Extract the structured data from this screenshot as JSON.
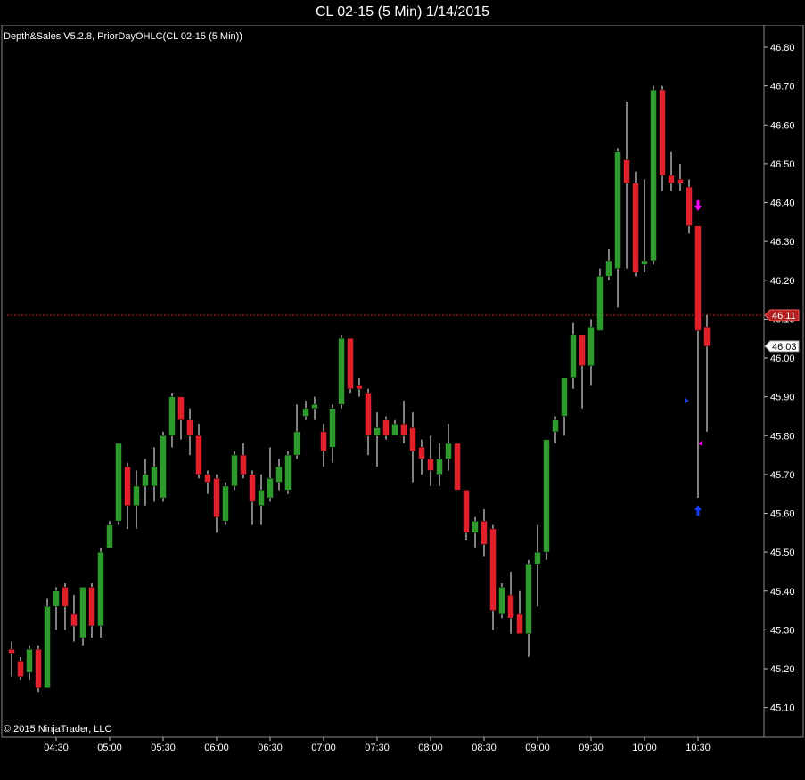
{
  "window": {
    "title": "CL 02-15 (5 Min)  1/14/2015"
  },
  "indicator_label": "Depth&Sales V5.2.8, PriorDayOHLC(CL 02-15 (5 Min))",
  "copyright": "© 2015 NinjaTrader, LLC",
  "colors": {
    "up": "#2e9a2e",
    "down": "#e0202a",
    "background": "#000000",
    "prior_close_line": "#b02020",
    "marker_down": "#ff00ff",
    "marker_up": "#1a3cff"
  },
  "chart_data": {
    "type": "candlestick",
    "title": "CL 02-15 (5 Min)  1/14/2015",
    "y_ticks": [
      "46.80",
      "46.70",
      "46.60",
      "46.50",
      "46.40",
      "46.30",
      "46.20",
      "46.10",
      "46.00",
      "45.90",
      "45.80",
      "45.70",
      "45.60",
      "45.50",
      "45.40",
      "45.30",
      "45.20",
      "45.10"
    ],
    "ylim": [
      45.05,
      46.88
    ],
    "x_ticks": [
      {
        "label": "04:30",
        "bar": 5
      },
      {
        "label": "05:00",
        "bar": 11
      },
      {
        "label": "05:30",
        "bar": 17
      },
      {
        "label": "06:00",
        "bar": 23
      },
      {
        "label": "06:30",
        "bar": 29
      },
      {
        "label": "07:00",
        "bar": 35
      },
      {
        "label": "07:30",
        "bar": 41
      },
      {
        "label": "08:00",
        "bar": 47
      },
      {
        "label": "08:30",
        "bar": 53
      },
      {
        "label": "09:00",
        "bar": 59
      },
      {
        "label": "09:30",
        "bar": 65
      },
      {
        "label": "10:00",
        "bar": 71
      },
      {
        "label": "10:30",
        "bar": 77
      }
    ],
    "prior_day_close": {
      "value": 46.11,
      "label": "46.11"
    },
    "last_price": {
      "value": 46.03,
      "label": "46.03"
    },
    "grid": false,
    "candles": [
      [
        45.25,
        45.24,
        45.27,
        45.18
      ],
      [
        45.22,
        45.18,
        45.23,
        45.17
      ],
      [
        45.19,
        45.25,
        45.26,
        45.17
      ],
      [
        45.25,
        45.15,
        45.26,
        45.14
      ],
      [
        45.15,
        45.36,
        45.38,
        45.15
      ],
      [
        45.36,
        45.4,
        45.41,
        45.3
      ],
      [
        45.41,
        45.36,
        45.42,
        45.3
      ],
      [
        45.34,
        45.31,
        45.39,
        45.27
      ],
      [
        45.28,
        45.41,
        45.41,
        45.26
      ],
      [
        45.41,
        45.31,
        45.42,
        45.28
      ],
      [
        45.31,
        45.5,
        45.51,
        45.28
      ],
      [
        45.51,
        45.57,
        45.58,
        45.51
      ],
      [
        45.58,
        45.78,
        45.78,
        45.57
      ],
      [
        45.72,
        45.62,
        45.73,
        45.56
      ],
      [
        45.62,
        45.67,
        45.71,
        45.56
      ],
      [
        45.67,
        45.7,
        45.74,
        45.62
      ],
      [
        45.67,
        45.72,
        45.77,
        45.63
      ],
      [
        45.64,
        45.8,
        45.81,
        45.63
      ],
      [
        45.8,
        45.9,
        45.91,
        45.77
      ],
      [
        45.9,
        45.84,
        45.9,
        45.79
      ],
      [
        45.84,
        45.8,
        45.87,
        45.75
      ],
      [
        45.8,
        45.7,
        45.83,
        45.69
      ],
      [
        45.7,
        45.68,
        45.71,
        45.65
      ],
      [
        45.69,
        45.59,
        45.7,
        45.55
      ],
      [
        45.58,
        45.67,
        45.68,
        45.57
      ],
      [
        45.67,
        45.75,
        45.76,
        45.66
      ],
      [
        45.75,
        45.7,
        45.78,
        45.69
      ],
      [
        45.7,
        45.63,
        45.71,
        45.57
      ],
      [
        45.62,
        45.66,
        45.7,
        45.57
      ],
      [
        45.64,
        45.69,
        45.77,
        45.63
      ],
      [
        45.68,
        45.72,
        45.74,
        45.66
      ],
      [
        45.66,
        45.75,
        45.76,
        45.65
      ],
      [
        45.75,
        45.81,
        45.88,
        45.74
      ],
      [
        45.85,
        45.87,
        45.89,
        45.84
      ],
      [
        45.87,
        45.88,
        45.9,
        45.84
      ],
      [
        45.81,
        45.76,
        45.83,
        45.72
      ],
      [
        45.77,
        45.87,
        45.88,
        45.73
      ],
      [
        45.88,
        46.05,
        46.06,
        45.87
      ],
      [
        46.05,
        45.92,
        46.05,
        45.91
      ],
      [
        45.93,
        45.92,
        45.95,
        45.9
      ],
      [
        45.91,
        45.8,
        45.92,
        45.75
      ],
      [
        45.8,
        45.82,
        45.86,
        45.72
      ],
      [
        45.84,
        45.8,
        45.85,
        45.79
      ],
      [
        45.8,
        45.83,
        45.84,
        45.8
      ],
      [
        45.83,
        45.8,
        45.89,
        45.78
      ],
      [
        45.82,
        45.76,
        45.86,
        45.68
      ],
      [
        45.77,
        45.74,
        45.79,
        45.7
      ],
      [
        45.74,
        45.71,
        45.8,
        45.67
      ],
      [
        45.7,
        45.74,
        45.78,
        45.67
      ],
      [
        45.74,
        45.78,
        45.83,
        45.71
      ],
      [
        45.78,
        45.66,
        45.78,
        45.66
      ],
      [
        45.66,
        45.55,
        45.66,
        45.53
      ],
      [
        45.55,
        45.58,
        45.59,
        45.51
      ],
      [
        45.58,
        45.52,
        45.61,
        45.49
      ],
      [
        45.56,
        45.35,
        45.57,
        45.3
      ],
      [
        45.34,
        45.41,
        45.42,
        45.33
      ],
      [
        45.39,
        45.33,
        45.45,
        45.29
      ],
      [
        45.34,
        45.29,
        45.4,
        45.29
      ],
      [
        45.29,
        45.47,
        45.48,
        45.23
      ],
      [
        45.47,
        45.5,
        45.57,
        45.36
      ],
      [
        45.5,
        45.79,
        45.79,
        45.48
      ],
      [
        45.81,
        45.84,
        45.85,
        45.78
      ],
      [
        45.85,
        45.95,
        45.95,
        45.8
      ],
      [
        45.95,
        46.06,
        46.09,
        45.92
      ],
      [
        46.06,
        45.98,
        46.06,
        45.87
      ],
      [
        45.98,
        46.08,
        46.1,
        45.93
      ],
      [
        46.07,
        46.21,
        46.23,
        46.07
      ],
      [
        46.21,
        46.25,
        46.28,
        46.2
      ],
      [
        46.23,
        46.53,
        46.54,
        46.13
      ],
      [
        46.51,
        46.45,
        46.66,
        46.23
      ],
      [
        46.45,
        46.22,
        46.48,
        46.21
      ],
      [
        46.24,
        46.25,
        46.46,
        46.22
      ],
      [
        46.25,
        46.69,
        46.7,
        46.24
      ],
      [
        46.69,
        46.47,
        46.7,
        46.43
      ],
      [
        46.47,
        46.45,
        46.53,
        46.43
      ],
      [
        46.46,
        46.45,
        46.5,
        46.43
      ],
      [
        46.44,
        46.34,
        46.46,
        46.32
      ],
      [
        46.34,
        46.07,
        46.34,
        45.64
      ],
      [
        46.08,
        46.03,
        46.11,
        45.81
      ]
    ],
    "signals": [
      {
        "bar": 77,
        "kind": "arrow-down",
        "price": 46.39,
        "color": "#ff00ff"
      },
      {
        "bar": 77,
        "kind": "arrow-up",
        "price": 45.61,
        "color": "#1a3cff"
      },
      {
        "bar": 77,
        "kind": "tick-left",
        "price": 45.78,
        "color": "#ff00ff"
      },
      {
        "bar": 76,
        "kind": "tick-right",
        "price": 45.89,
        "color": "#1a3cff"
      }
    ]
  }
}
